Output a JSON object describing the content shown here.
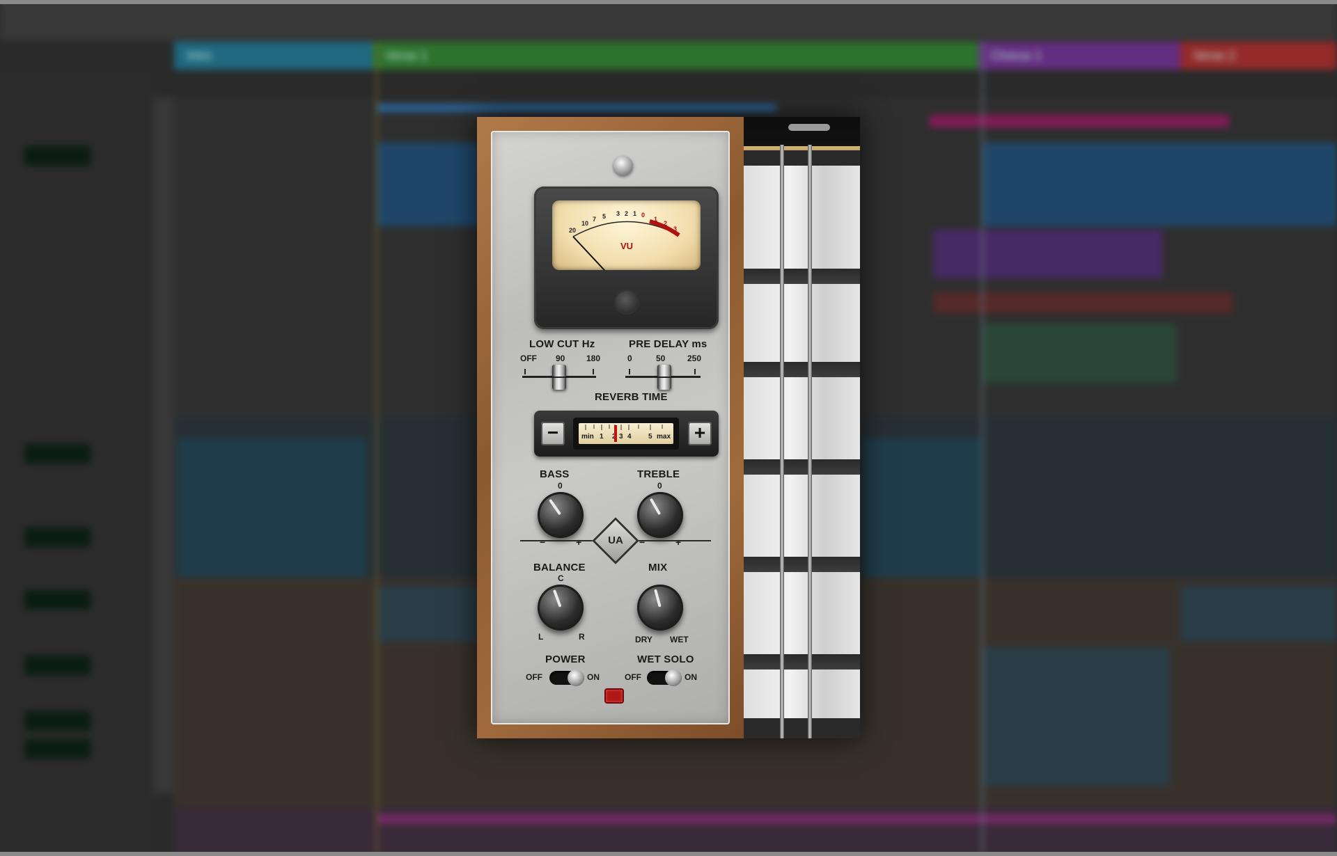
{
  "daw": {
    "sections": [
      {
        "label": "Intro",
        "color": "#1f6f8a"
      },
      {
        "label": "Verse 1",
        "color": "#2e7a2e"
      },
      {
        "label": "Chorus 1",
        "color": "#6a2e8a"
      },
      {
        "label": "Verse 2",
        "color": "#a02a2a"
      }
    ]
  },
  "plugin": {
    "meter": {
      "label": "VU"
    },
    "low_cut": {
      "label": "LOW CUT Hz",
      "ticks": [
        "OFF",
        "90",
        "180"
      ],
      "value": 0.5
    },
    "pre_delay": {
      "label": "PRE DELAY ms",
      "ticks": [
        "0",
        "50",
        "250"
      ],
      "value": 0.52
    },
    "reverb_time": {
      "label": "REVERB TIME",
      "minus": "−",
      "plus": "+",
      "scale_min": "min",
      "scale_max": "max",
      "scale": [
        "1",
        "2",
        "3",
        "4",
        "5"
      ],
      "value": 0.36
    },
    "bass": {
      "label": "BASS",
      "center": "0",
      "minus": "−",
      "plus": "+"
    },
    "treble": {
      "label": "TREBLE",
      "center": "0",
      "minus": "−",
      "plus": "+"
    },
    "balance": {
      "label": "BALANCE",
      "center": "C",
      "left": "L",
      "right": "R"
    },
    "mix": {
      "label": "MIX",
      "left": "DRY",
      "right": "WET"
    },
    "power": {
      "label": "POWER",
      "off": "OFF",
      "on": "ON",
      "state": "on"
    },
    "wet_solo": {
      "label": "WET SOLO",
      "off": "OFF",
      "on": "ON",
      "state": "on"
    },
    "logo": "UA"
  }
}
